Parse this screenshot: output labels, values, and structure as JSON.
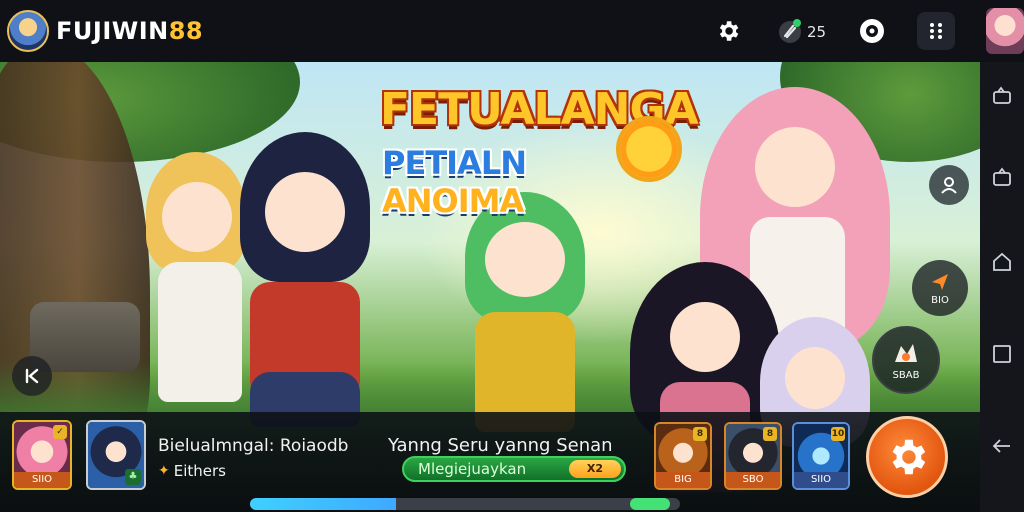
{
  "header": {
    "brand_text": "FUJIWIN",
    "brand_accent": "88",
    "coin_count": "25",
    "icons": [
      "gear-icon",
      "coin-icon",
      "help-icon",
      "grid-menu-icon"
    ]
  },
  "hero": {
    "title_line1": "FETUALANGA",
    "title_line2_main": "PETIALN ",
    "title_line2_accent": "ANOIMA",
    "send_label": "BIO",
    "reward_label": "SBAB"
  },
  "hud": {
    "left_cards": [
      {
        "price": "SIIO",
        "badge": "✓"
      },
      {
        "chip": "♣"
      }
    ],
    "info_title": "Bielualmngal: Roiaodb",
    "info_sub": "Eithers",
    "promo_title": "Yanng Seru yanng Senan",
    "promo_text": "Mlegiejuaykan",
    "promo_pill": "X2",
    "progress": 0.34,
    "right_cards": [
      {
        "price": "BIG",
        "badge": "8"
      },
      {
        "price": "SBO",
        "badge": "8"
      },
      {
        "price": "SIIO",
        "badge": "10"
      }
    ]
  },
  "colors": {
    "brand_accent": "#ffc233",
    "title_gold": "#ffc62a",
    "title_blue": "#2b7de0",
    "promo_green": "#2aa743",
    "action_orange": "#e2560f"
  }
}
